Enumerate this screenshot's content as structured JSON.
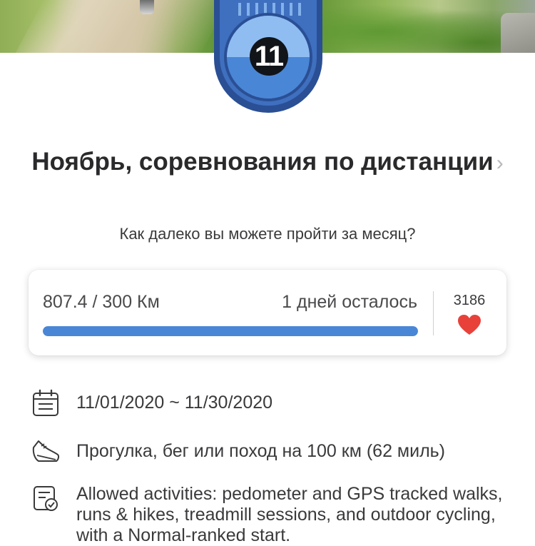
{
  "badge": {
    "number": "11"
  },
  "challenge": {
    "title": "Ноябрь, соревнования по дистанции",
    "chevron": "›",
    "subtitle": "Как далеко вы можете пройти за месяц?"
  },
  "progress": {
    "distance_text": "807.4 / 300 Км",
    "days_left": "1 дней осталось",
    "fill_fraction": 1.0
  },
  "likes": {
    "count": "3186"
  },
  "details": {
    "dates": "11/01/2020 ~ 11/30/2020",
    "goal": "Прогулка, бег или поход на 100 км (62 миль)",
    "activities": "Allowed activities: pedometer and GPS tracked walks, runs & hikes, treadmill sessions, and outdoor cycling, with a Normal-ranked start."
  },
  "icons": {
    "date": "calendar-icon",
    "goal": "sneaker-icon",
    "activities": "checklist-icon",
    "like": "heart-icon"
  },
  "colors": {
    "badge_dark": "#2a4f94",
    "badge_mid": "#4a86d6",
    "badge_light": "#8fbdf2",
    "progress": "#4a86d6",
    "heart": "#e8413a"
  }
}
